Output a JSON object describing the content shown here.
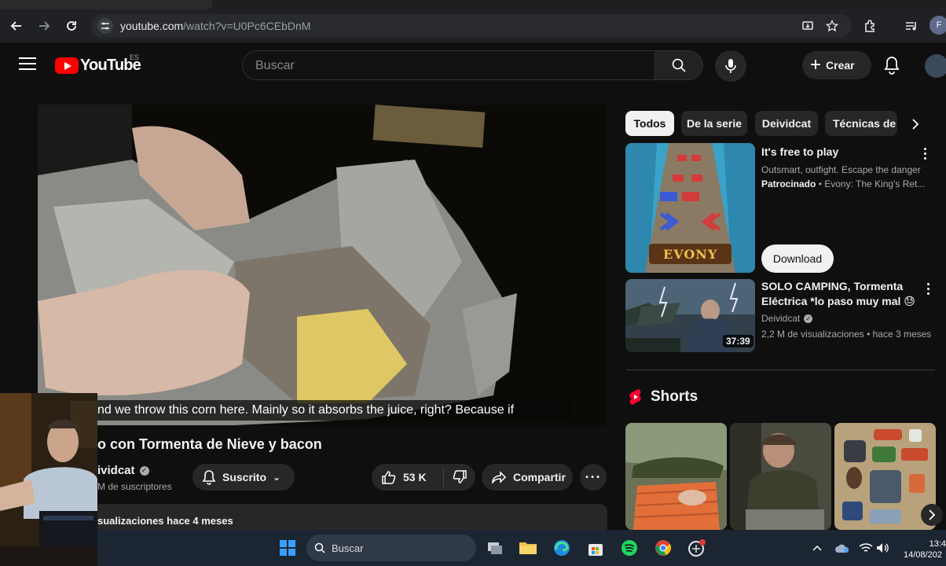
{
  "browser": {
    "url_host": "youtube.com",
    "url_path": "/watch?v=U0Pc6CEbDnM",
    "profile_initial": "F"
  },
  "youtube": {
    "logo_text": "YouTube",
    "country_code": "ES",
    "search_placeholder": "Buscar",
    "create_label": "Crear"
  },
  "video": {
    "caption": "nd we throw this corn here. Mainly so it absorbs the juice, right? Because if",
    "title": "o con Tormenta de Nieve y bacon",
    "channel": "ividcat",
    "subscribers": "M de suscriptores",
    "subscribe_label": "Suscrito",
    "likes": "53 K",
    "share_label": "Compartir",
    "views_meta": "sualizaciones  hace 4 meses"
  },
  "sidebar": {
    "chips": [
      "Todos",
      "De la serie",
      "Deividcat",
      "Técnicas de"
    ],
    "ad": {
      "title": "It's free to play",
      "description": "Outsmart, outfight. Escape the danger",
      "sponsored": "Patrocinado",
      "advertiser": "Evony: The King's Ret...",
      "cta": "Download",
      "thumb_text": "EVONY"
    },
    "video": {
      "title_line1": "SOLO CAMPING, Tormenta",
      "title_line2": "Eléctrica *lo paso muy mal 😓",
      "channel": "Deividcat",
      "meta": "2,2 M de visualizaciones • hace 3 meses",
      "duration": "37:39"
    },
    "shorts_label": "Shorts"
  },
  "taskbar": {
    "search_label": "Buscar",
    "time": "13:4",
    "date": "14/08/202"
  }
}
